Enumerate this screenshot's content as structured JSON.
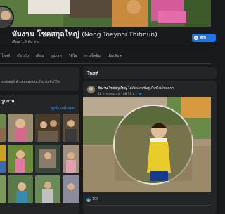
{
  "profile": {
    "name_thai": "หัมงาน โชคสกุลใหญ่",
    "name_en": "(Nong Toeynoi Thitinun)",
    "friends_count": "เพื่อน 1.6 พัน คน",
    "message_label": "ส่งข"
  },
  "tabs": [
    {
      "label": "โพสต์"
    },
    {
      "label": "เกี่ยวกับ"
    },
    {
      "label": "เพื่อน"
    },
    {
      "label": "รูปภาพ"
    },
    {
      "label": "วิดีโอ"
    },
    {
      "label": "การเช็คอิน"
    },
    {
      "label": "เพิ่มเติม"
    }
  ],
  "intro": {
    "text": "อาศัยอยู่ที่ ตำบลหนองแคน อำเภอสร้างวิไล"
  },
  "photos": {
    "title": "รูปภาพ",
    "see_all": "ดูรูปภาพทั้งหมด"
  },
  "posts": {
    "title": "โพสต์"
  },
  "post": {
    "author": "หัมงาน โชคสกุลใหญ่",
    "action": "ได้เปิดแคปชั่นรูปโปรไฟล์ของเขา",
    "time": "18 กรกฎาคม เวลา 08:58 น. · 👥",
    "like_count": "108"
  },
  "colors": {
    "background": "#18191a",
    "card": "#242526",
    "accent": "#2374e1",
    "link": "#4599ff"
  }
}
